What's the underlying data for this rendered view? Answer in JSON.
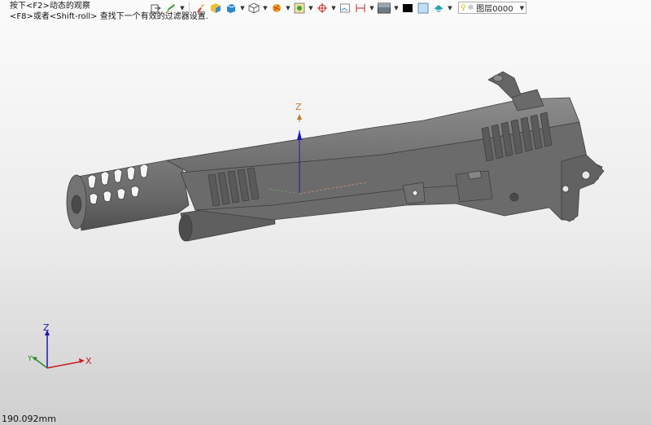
{
  "hints": {
    "line1": "按下<F2>动态的观察",
    "line2": "<F8>或者<Shift-roll> 查找下一个有效的过滤器设置."
  },
  "toolbar": {
    "icons": [
      "exit-sketch-icon",
      "sketch-pencil-icon",
      "brush-icon",
      "cube-color-icon",
      "box-view-icon",
      "wireframe-cube-icon",
      "render-sphere-icon",
      "appearance-icon",
      "section-target-icon",
      "view-plane-icon",
      "dimension-icon",
      "background-icon",
      "black-color-swatch",
      "lightblue-color-swatch",
      "scene-icon"
    ],
    "layer_label": "图层0000"
  },
  "triad": {
    "x": "X",
    "y": "Y",
    "z": "Z"
  },
  "model_axis": {
    "z": "Z"
  },
  "status": {
    "measure": "190.092mm"
  },
  "colors": {
    "model": "#6e6e6e",
    "model_edge": "#3e3e3e",
    "axis_x": "#c81e1e",
    "axis_y": "#2a8a2a",
    "axis_z": "#1a1ab4"
  }
}
